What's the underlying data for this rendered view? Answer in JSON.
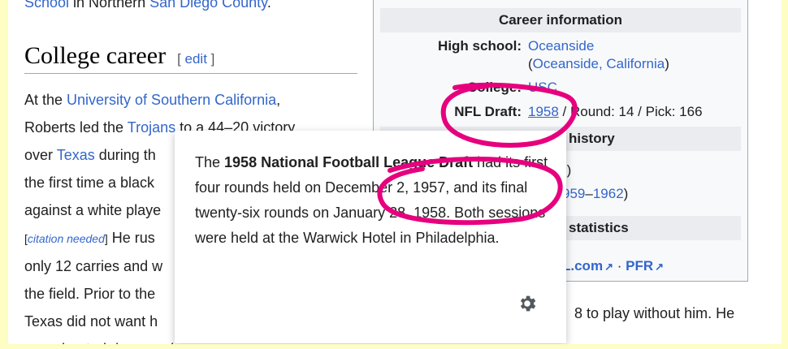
{
  "article": {
    "top_line_prefix": "School",
    "top_line_middle": " in Northern ",
    "top_line_link": "San Diego County",
    "top_line_suffix": ".",
    "section_title": "College career",
    "edit_open": "[ ",
    "edit_label": "edit",
    "edit_close": " ]",
    "lines": [
      {
        "pre": "At the ",
        "link": "University of Southern California",
        "post": ","
      },
      {
        "pre": "Roberts led the ",
        "link": "Trojans",
        "post": " to a 44–20 victory"
      },
      {
        "pre": "over ",
        "link": "Texas",
        "post": " during th"
      },
      {
        "pre": "the first time a black",
        "link": "",
        "post": ""
      },
      {
        "pre": "against a white playe",
        "link": "",
        "post": ""
      },
      {
        "pre": "",
        "link": "",
        "post": " He rus"
      },
      {
        "pre": "only 12 carries and w",
        "link": "",
        "post": ""
      },
      {
        "pre": "the field. Prior to the",
        "link": "",
        "post": ""
      },
      {
        "pre": "Texas did not want h",
        "link": "",
        "post": ""
      },
      {
        "pre": "was shouted down and",
        "link": "",
        "post": ""
      }
    ],
    "citation_needed": "citation needed",
    "trailing_text": "8 to play without him. He"
  },
  "infobox": {
    "career_header": "Career information",
    "high_school_label": "High school:",
    "high_school_value": "Oceanside",
    "high_school_loc_open": "(",
    "high_school_loc": "Oceanside, California",
    "high_school_loc_close": ")",
    "college_label": "College:",
    "college_value": "USC",
    "draft_label": "NFL Draft:",
    "draft_year": "1958",
    "draft_rest": " / Round: 14 / Pick: 166",
    "history_header_partial": "history",
    "history_line1_tail": "))",
    "history_line2_link_a": "959",
    "history_line2_dash": "–",
    "history_line2_link_b": "1962",
    "history_line2_close": ")",
    "stats_header_partial": "statistics",
    "link_nfl_partial": "L.com",
    "separator": "·",
    "link_pfr": "PFR"
  },
  "popup": {
    "text_before": "The ",
    "text_bold": "1958 National Football League Draft",
    "text_after": " had its first four rounds held on December 2, 1957, and its final twenty-six rounds on January 28, 1958. Both sessions were held at the Warwick Hotel in Philadelphia.",
    "settings_icon": "gear-icon"
  },
  "colors": {
    "link": "#3366cc",
    "highlight_frame": "#fdfdc4",
    "annotation": "#e6007e"
  }
}
